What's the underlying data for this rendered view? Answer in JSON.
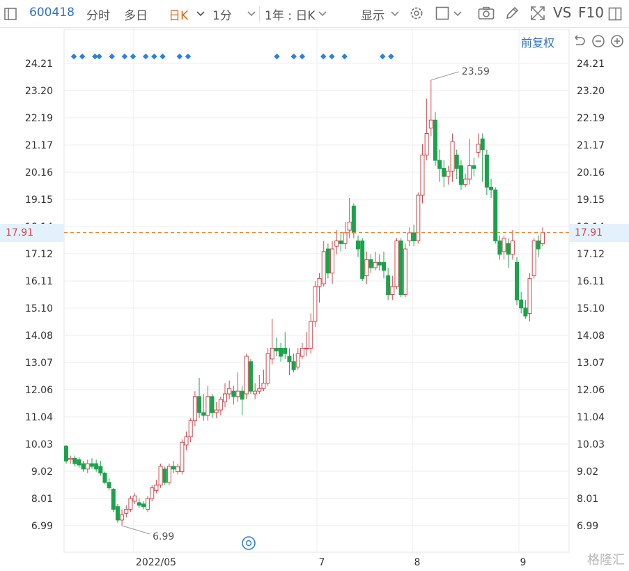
{
  "toolbar": {
    "stock_code": "600418",
    "intraday": "分时",
    "multi_day": "多日",
    "daily_k": "日K",
    "minute": "1分",
    "range": "1年 : 日K",
    "display": "显示",
    "vs": "VS",
    "f10": "F10",
    "accent": "#2f72c4",
    "active": "#e8630a",
    "icons": [
      "panel-icon",
      "chevron-down-icon",
      "settings-icon",
      "square-icon",
      "camera-icon",
      "pencil-icon",
      "fullscreen-icon",
      "maximize-icon"
    ]
  },
  "adjust_label": "前复权",
  "controls": [
    "undo-icon",
    "zoom-out-icon",
    "zoom-in-icon"
  ],
  "current_price_label": "17.91",
  "watermark": "格隆汇",
  "chart_data": {
    "type": "candlestick",
    "y_ticks": [
      "24.21",
      "23.20",
      "22.19",
      "21.17",
      "20.16",
      "19.15",
      "18.14",
      "17.12",
      "16.11",
      "15.10",
      "14.08",
      "13.07",
      "12.06",
      "11.04",
      "10.03",
      "9.02",
      "8.01",
      "6.99"
    ],
    "ylim": [
      6.99,
      24.21
    ],
    "x_ticks": [
      "2022/05",
      "7",
      "8",
      "9"
    ],
    "current_price": 17.91,
    "annotations": [
      {
        "text": "23.59",
        "value": 23.59
      },
      {
        "text": "6.99",
        "value": 6.99
      }
    ],
    "colors": {
      "up": "#d6474d",
      "down": "#1aa34a",
      "current_line": "#e8833a",
      "marker": "#2f80d8"
    },
    "candles": [
      {
        "o": 9.95,
        "c": 9.4,
        "h": 10.0,
        "l": 9.3
      },
      {
        "o": 9.45,
        "c": 9.5,
        "h": 9.6,
        "l": 9.3
      },
      {
        "o": 9.5,
        "c": 9.3,
        "h": 9.6,
        "l": 9.2
      },
      {
        "o": 9.45,
        "c": 9.25,
        "h": 9.55,
        "l": 9.15
      },
      {
        "o": 9.3,
        "c": 9.1,
        "h": 9.4,
        "l": 9.0
      },
      {
        "o": 9.1,
        "c": 9.3,
        "h": 9.45,
        "l": 8.95
      },
      {
        "o": 9.3,
        "c": 9.2,
        "h": 9.5,
        "l": 9.1
      },
      {
        "o": 9.3,
        "c": 9.1,
        "h": 9.45,
        "l": 9.0
      },
      {
        "o": 9.2,
        "c": 8.95,
        "h": 9.4,
        "l": 8.85
      },
      {
        "o": 8.95,
        "c": 8.6,
        "h": 9.0,
        "l": 8.55
      },
      {
        "o": 8.6,
        "c": 8.4,
        "h": 8.75,
        "l": 8.3
      },
      {
        "o": 8.35,
        "c": 7.6,
        "h": 8.4,
        "l": 7.5
      },
      {
        "o": 7.7,
        "c": 7.2,
        "h": 7.8,
        "l": 7.1
      },
      {
        "o": 7.2,
        "c": 7.4,
        "h": 7.6,
        "l": 6.99
      },
      {
        "o": 7.45,
        "c": 7.6,
        "h": 7.75,
        "l": 7.3
      },
      {
        "o": 7.6,
        "c": 8.0,
        "h": 8.1,
        "l": 7.5
      },
      {
        "o": 7.9,
        "c": 8.1,
        "h": 8.2,
        "l": 7.8
      },
      {
        "o": 7.85,
        "c": 7.75,
        "h": 8.0,
        "l": 7.65
      },
      {
        "o": 7.8,
        "c": 7.7,
        "h": 7.9,
        "l": 7.6
      },
      {
        "o": 7.6,
        "c": 8.0,
        "h": 8.1,
        "l": 7.5
      },
      {
        "o": 8.0,
        "c": 8.4,
        "h": 8.5,
        "l": 7.9
      },
      {
        "o": 8.3,
        "c": 8.5,
        "h": 8.7,
        "l": 8.2
      },
      {
        "o": 8.5,
        "c": 9.2,
        "h": 9.3,
        "l": 8.4
      },
      {
        "o": 9.1,
        "c": 8.6,
        "h": 9.2,
        "l": 8.5
      },
      {
        "o": 8.6,
        "c": 9.2,
        "h": 9.3,
        "l": 8.5
      },
      {
        "o": 9.2,
        "c": 9.1,
        "h": 9.4,
        "l": 8.95
      },
      {
        "o": 9.0,
        "c": 9.2,
        "h": 9.3,
        "l": 8.9
      },
      {
        "o": 9.0,
        "c": 10.1,
        "h": 10.2,
        "l": 8.9
      },
      {
        "o": 10.0,
        "c": 10.3,
        "h": 10.5,
        "l": 9.8
      },
      {
        "o": 10.3,
        "c": 10.9,
        "h": 11.0,
        "l": 10.1
      },
      {
        "o": 10.9,
        "c": 11.8,
        "h": 12.0,
        "l": 10.7
      },
      {
        "o": 11.8,
        "c": 11.2,
        "h": 12.5,
        "l": 11.0
      },
      {
        "o": 11.2,
        "c": 11.1,
        "h": 11.9,
        "l": 10.9
      },
      {
        "o": 11.1,
        "c": 11.8,
        "h": 12.2,
        "l": 10.9
      },
      {
        "o": 11.8,
        "c": 11.2,
        "h": 11.9,
        "l": 11.0
      },
      {
        "o": 11.2,
        "c": 11.3,
        "h": 11.6,
        "l": 11.0
      },
      {
        "o": 11.3,
        "c": 11.7,
        "h": 11.8,
        "l": 11.1
      },
      {
        "o": 11.6,
        "c": 11.9,
        "h": 12.3,
        "l": 11.4
      },
      {
        "o": 11.9,
        "c": 12.1,
        "h": 12.4,
        "l": 11.7
      },
      {
        "o": 12.0,
        "c": 11.8,
        "h": 12.2,
        "l": 11.5
      },
      {
        "o": 11.8,
        "c": 12.0,
        "h": 12.7,
        "l": 11.6
      },
      {
        "o": 12.0,
        "c": 11.7,
        "h": 12.2,
        "l": 11.1
      },
      {
        "o": 11.9,
        "c": 13.3,
        "h": 13.4,
        "l": 11.7
      },
      {
        "o": 13.1,
        "c": 12.0,
        "h": 13.2,
        "l": 11.9
      },
      {
        "o": 11.9,
        "c": 12.0,
        "h": 12.3,
        "l": 11.7
      },
      {
        "o": 12.0,
        "c": 12.1,
        "h": 12.6,
        "l": 11.9
      },
      {
        "o": 12.1,
        "c": 12.3,
        "h": 12.8,
        "l": 12.0
      },
      {
        "o": 12.3,
        "c": 13.4,
        "h": 13.6,
        "l": 12.2
      },
      {
        "o": 13.2,
        "c": 13.6,
        "h": 14.7,
        "l": 13.0
      },
      {
        "o": 13.6,
        "c": 13.5,
        "h": 14.0,
        "l": 13.3
      },
      {
        "o": 13.6,
        "c": 13.3,
        "h": 13.8,
        "l": 13.1
      },
      {
        "o": 13.6,
        "c": 13.4,
        "h": 14.2,
        "l": 13.2
      },
      {
        "o": 13.3,
        "c": 13.1,
        "h": 13.6,
        "l": 12.6
      },
      {
        "o": 13.1,
        "c": 12.8,
        "h": 13.4,
        "l": 12.7
      },
      {
        "o": 12.9,
        "c": 13.4,
        "h": 13.6,
        "l": 12.8
      },
      {
        "o": 13.3,
        "c": 13.6,
        "h": 13.8,
        "l": 13.2
      },
      {
        "o": 13.6,
        "c": 13.6,
        "h": 14.2,
        "l": 13.3
      },
      {
        "o": 13.6,
        "c": 14.6,
        "h": 14.9,
        "l": 13.4
      },
      {
        "o": 14.6,
        "c": 15.9,
        "h": 16.1,
        "l": 14.4
      },
      {
        "o": 15.9,
        "c": 16.2,
        "h": 16.4,
        "l": 15.3
      },
      {
        "o": 16.0,
        "c": 17.2,
        "h": 17.6,
        "l": 15.9
      },
      {
        "o": 17.3,
        "c": 16.4,
        "h": 17.5,
        "l": 16.2
      },
      {
        "o": 16.4,
        "c": 17.3,
        "h": 17.6,
        "l": 16.0
      },
      {
        "o": 17.4,
        "c": 17.6,
        "h": 18.0,
        "l": 17.1
      },
      {
        "o": 17.6,
        "c": 17.5,
        "h": 17.9,
        "l": 17.2
      },
      {
        "o": 17.5,
        "c": 17.9,
        "h": 18.3,
        "l": 17.3
      },
      {
        "o": 18.0,
        "c": 18.3,
        "h": 19.2,
        "l": 17.7
      },
      {
        "o": 18.9,
        "c": 17.9,
        "h": 19.0,
        "l": 17.7
      },
      {
        "o": 17.6,
        "c": 17.3,
        "h": 17.8,
        "l": 17.0
      },
      {
        "o": 17.6,
        "c": 16.2,
        "h": 17.7,
        "l": 16.1
      },
      {
        "o": 16.3,
        "c": 16.9,
        "h": 17.2,
        "l": 16.0
      },
      {
        "o": 16.9,
        "c": 16.6,
        "h": 17.1,
        "l": 16.4
      },
      {
        "o": 16.6,
        "c": 16.8,
        "h": 17.2,
        "l": 16.5
      },
      {
        "o": 16.8,
        "c": 16.7,
        "h": 17.1,
        "l": 16.5
      },
      {
        "o": 16.8,
        "c": 16.5,
        "h": 17.2,
        "l": 16.2
      },
      {
        "o": 16.3,
        "c": 15.6,
        "h": 16.6,
        "l": 15.4
      },
      {
        "o": 15.6,
        "c": 15.9,
        "h": 16.3,
        "l": 15.4
      },
      {
        "o": 15.9,
        "c": 17.6,
        "h": 17.7,
        "l": 15.8
      },
      {
        "o": 17.6,
        "c": 15.6,
        "h": 17.7,
        "l": 15.5
      },
      {
        "o": 15.6,
        "c": 17.3,
        "h": 17.5,
        "l": 15.5
      },
      {
        "o": 17.6,
        "c": 17.9,
        "h": 18.1,
        "l": 17.4
      },
      {
        "o": 17.9,
        "c": 17.6,
        "h": 18.2,
        "l": 17.4
      },
      {
        "o": 17.6,
        "c": 19.3,
        "h": 19.4,
        "l": 17.5
      },
      {
        "o": 19.3,
        "c": 20.8,
        "h": 21.2,
        "l": 19.0
      },
      {
        "o": 20.8,
        "c": 21.6,
        "h": 22.9,
        "l": 20.6
      },
      {
        "o": 21.8,
        "c": 22.1,
        "h": 23.59,
        "l": 21.5
      },
      {
        "o": 22.1,
        "c": 20.6,
        "h": 22.4,
        "l": 20.4
      },
      {
        "o": 20.6,
        "c": 20.3,
        "h": 21.0,
        "l": 19.8
      },
      {
        "o": 20.3,
        "c": 20.0,
        "h": 20.6,
        "l": 19.6
      },
      {
        "o": 20.0,
        "c": 20.2,
        "h": 20.4,
        "l": 19.7
      },
      {
        "o": 20.2,
        "c": 21.3,
        "h": 21.6,
        "l": 19.8
      },
      {
        "o": 20.8,
        "c": 20.3,
        "h": 21.0,
        "l": 19.9
      },
      {
        "o": 20.4,
        "c": 19.7,
        "h": 20.6,
        "l": 19.5
      },
      {
        "o": 19.7,
        "c": 19.9,
        "h": 20.1,
        "l": 19.6
      },
      {
        "o": 19.9,
        "c": 20.4,
        "h": 21.4,
        "l": 19.7
      },
      {
        "o": 20.4,
        "c": 20.3,
        "h": 20.7,
        "l": 20.0
      },
      {
        "o": 20.9,
        "c": 21.2,
        "h": 21.6,
        "l": 20.7
      },
      {
        "o": 21.4,
        "c": 21.0,
        "h": 21.6,
        "l": 19.8
      },
      {
        "o": 20.8,
        "c": 19.6,
        "h": 21.0,
        "l": 19.3
      },
      {
        "o": 19.6,
        "c": 19.5,
        "h": 19.9,
        "l": 19.2
      },
      {
        "o": 19.5,
        "c": 17.6,
        "h": 19.6,
        "l": 17.5
      },
      {
        "o": 17.6,
        "c": 17.1,
        "h": 17.8,
        "l": 16.9
      },
      {
        "o": 17.2,
        "c": 17.7,
        "h": 17.8,
        "l": 16.9
      },
      {
        "o": 17.5,
        "c": 17.1,
        "h": 17.7,
        "l": 16.6
      },
      {
        "o": 17.1,
        "c": 17.6,
        "h": 18.0,
        "l": 16.9
      },
      {
        "o": 16.8,
        "c": 15.4,
        "h": 17.0,
        "l": 15.2
      },
      {
        "o": 15.4,
        "c": 15.1,
        "h": 15.7,
        "l": 14.9
      },
      {
        "o": 15.1,
        "c": 14.8,
        "h": 15.4,
        "l": 14.7
      },
      {
        "o": 14.9,
        "c": 16.2,
        "h": 16.4,
        "l": 14.6
      },
      {
        "o": 16.3,
        "c": 17.6,
        "h": 17.7,
        "l": 16.2
      },
      {
        "o": 17.6,
        "c": 17.3,
        "h": 17.8,
        "l": 17.0
      },
      {
        "o": 17.5,
        "c": 17.91,
        "h": 18.1,
        "l": 17.4
      }
    ],
    "markers": [
      0,
      2,
      5,
      6,
      9,
      12,
      14,
      17,
      19,
      21,
      25,
      27,
      48,
      52,
      54,
      59,
      61,
      64,
      73,
      75
    ]
  }
}
